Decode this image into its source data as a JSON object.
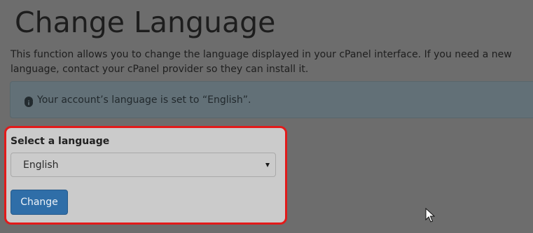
{
  "page": {
    "title": "Change Language",
    "description": "This function allows you to change the language displayed in your cPanel interface. If you need a new language, contact your cPanel provider so they can install it."
  },
  "alert": {
    "icon": "info-icon",
    "text": "Your account’s language is set to “English”."
  },
  "form": {
    "label": "Select a language",
    "selected_language": "English",
    "submit_label": "Change"
  },
  "colors": {
    "highlight_border": "#e21a1a",
    "button": "#2f6ea8"
  }
}
